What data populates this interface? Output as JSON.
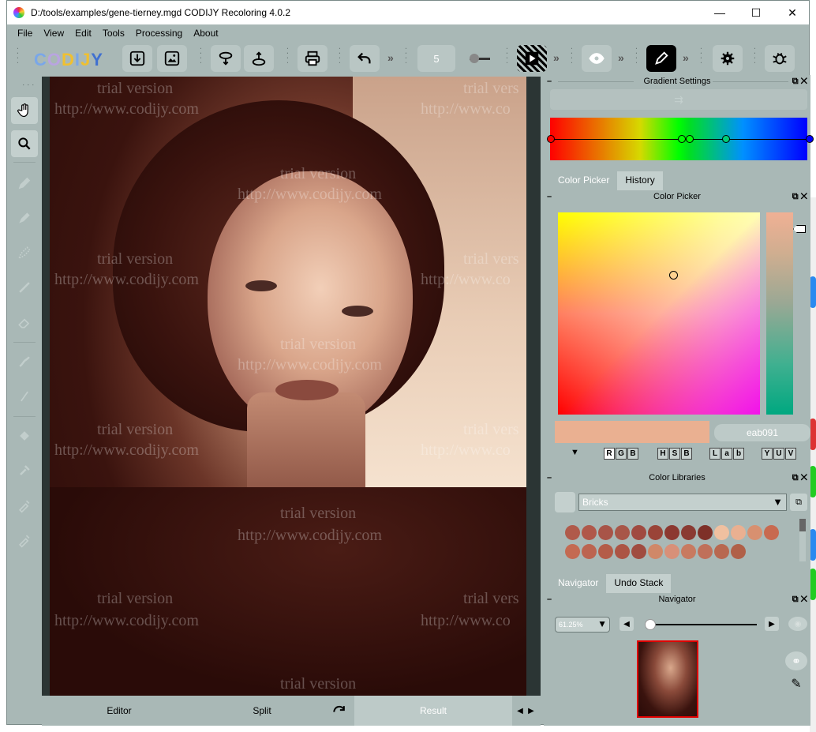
{
  "window": {
    "title": "D:/tools/examples/gene-tierney.mgd CODIJY Recoloring 4.0.2",
    "minimize": "—",
    "maximize": "☐",
    "close": "✕"
  },
  "menu": [
    "File",
    "Edit",
    "Tools",
    "Processing",
    "About",
    "View"
  ],
  "menu_order": [
    "File",
    "View",
    "Edit",
    "Tools",
    "Processing",
    "About"
  ],
  "toolbar": {
    "logo_text": "CODIJY",
    "brush_size": "5",
    "more": "»"
  },
  "watermark": {
    "line1": "trial version",
    "line2": "http://www.codijy.com",
    "line1_cut": "trial vers",
    "line2_cut": "http://www.co"
  },
  "view_tabs": {
    "editor": "Editor",
    "split": "Split",
    "result": "Result"
  },
  "gradient_settings": {
    "title": "Gradient Settings"
  },
  "color_panel": {
    "tabs": [
      "Color Picker",
      "History"
    ],
    "title": "Color Picker",
    "hex": "eab091",
    "current_color": "#eab091",
    "rgb": [
      "R",
      "G",
      "B"
    ],
    "hsb": [
      "H",
      "S",
      "B"
    ],
    "lab": [
      "L",
      "a",
      "b"
    ],
    "yuv": [
      "Y",
      "U",
      "V"
    ]
  },
  "libraries": {
    "title": "Color Libraries",
    "selected": "Bricks",
    "swatches": [
      "#b05a4a",
      "#b0584a",
      "#a85448",
      "#a85648",
      "#a04a40",
      "#9a4438",
      "#8c3830",
      "#8a3a32",
      "#7e3028",
      "#f0c0a0",
      "#eab091",
      "#d89070",
      "#c86a50",
      "#c46a52",
      "#bc6450",
      "#b45c48",
      "#ac5444",
      "#a04c40",
      "#d08868",
      "#d89078",
      "#c87a60",
      "#c0705a",
      "#b86850",
      "#b06048"
    ]
  },
  "navigator": {
    "tabs": [
      "Navigator",
      "Undo Stack"
    ],
    "title": "Navigator",
    "zoom": "61.25%"
  }
}
